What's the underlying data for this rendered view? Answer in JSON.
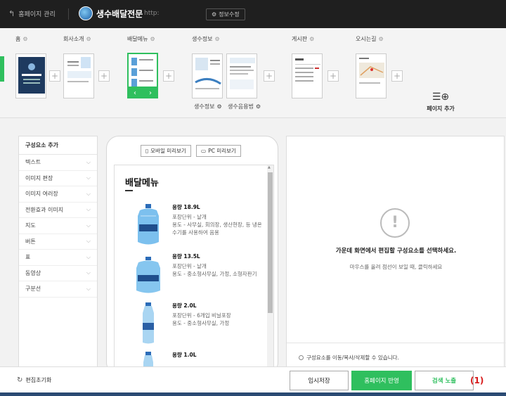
{
  "topbar": {
    "back_label": "홈페이지 관리",
    "site_title": "생수배달전문",
    "url_fragment": "http:",
    "info_button": "정보수정"
  },
  "pages": [
    {
      "label": "홈"
    },
    {
      "label": "회사소개"
    },
    {
      "label": "배달메뉴"
    },
    {
      "label": "생수정보"
    },
    {
      "label": "게시판"
    },
    {
      "label": "오시는길"
    }
  ],
  "subpages": [
    {
      "label": "생수정보"
    },
    {
      "label": "생수음용법"
    }
  ],
  "page_add_label": "페이지 추가",
  "components": {
    "header": "구성요소 추가",
    "items": [
      "텍스트",
      "이미지 편장",
      "이미지 여러장",
      "전환효과 이미지",
      "지도",
      "버튼",
      "표",
      "동영상",
      "구분선"
    ]
  },
  "preview": {
    "mobile_btn": "모바일 미리보기",
    "pc_btn": "PC 미리보기",
    "menu_title": "배달메뉴",
    "products": [
      {
        "name": "용량 18.9L",
        "desc": "포장단위 - 낱개\n용도 - 사무실, 회의장, 생산현장, 등 냉온수기를 사용하여 음용"
      },
      {
        "name": "용량 13.5L",
        "desc": "포장단위 - 낱개\n용도 - 중소형사무실, 가정, 소형자판기"
      },
      {
        "name": "용량 2.0L",
        "desc": "포장단위 - 6개입 비닐포장\n용도 - 중소형사무실, 가정"
      },
      {
        "name": "용량 1.0L",
        "desc": ""
      }
    ]
  },
  "right_panel": {
    "message": "가운데 화면에서 편집할 구성요소를 선택하세요.",
    "sub": "마우스를 올려 점선이 보일 때, 클릭하세요",
    "note": "구성요소를 이동/복사/삭제할 수 있습니다."
  },
  "bottom": {
    "reset_label": "편집초기화",
    "save_label": "임시저장",
    "apply_label": "홈페이지 반영",
    "search_label": "검색 노출",
    "annotation": "(1)"
  },
  "colors": {
    "accent_green": "#2fbf5e",
    "topbar_bg": "#1f1f1f",
    "annotation_red": "#d81b1b"
  }
}
